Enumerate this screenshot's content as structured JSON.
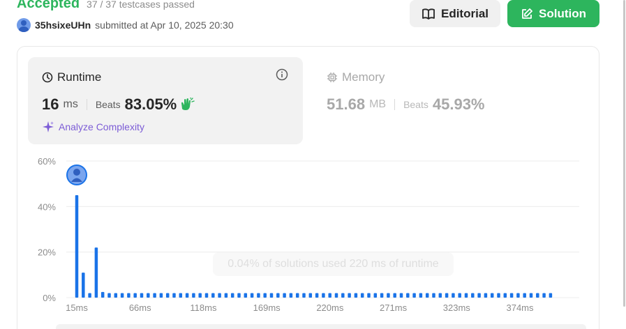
{
  "status": {
    "label": "Accepted",
    "passed": "37 / 37 testcases passed"
  },
  "submitter": {
    "name": "35hsixeUHn",
    "submitted_text": "submitted at Apr 10, 2025 20:30"
  },
  "buttons": {
    "editorial": "Editorial",
    "solution": "Solution"
  },
  "runtime": {
    "title": "Runtime",
    "value": "16",
    "unit": "ms",
    "beats_label": "Beats",
    "beats_value": "83.05%",
    "analyze": "Analyze Complexity"
  },
  "memory": {
    "title": "Memory",
    "value": "51.68",
    "unit": "MB",
    "beats_label": "Beats",
    "beats_value": "45.93%"
  },
  "tooltip": "0.04% of solutions used 220 ms of runtime",
  "colors": {
    "accent_green": "#2db55d",
    "bar_blue": "#1a73e8",
    "analyze_purple": "#7c5cd6"
  },
  "chart_data": {
    "type": "bar",
    "ytick_labels": [
      "0%",
      "20%",
      "40%",
      "60%"
    ],
    "ylim": [
      0,
      60
    ],
    "xtick_labels": [
      "15ms",
      "66ms",
      "118ms",
      "169ms",
      "220ms",
      "271ms",
      "323ms",
      "374ms"
    ],
    "values": [
      45,
      11,
      2,
      22,
      2.5,
      2,
      2,
      2,
      2,
      2,
      2,
      2,
      2,
      2,
      2,
      2,
      2,
      2,
      2,
      2,
      2,
      2,
      2,
      2,
      2,
      2,
      2,
      2,
      2,
      2,
      2,
      2,
      2,
      2,
      2,
      2,
      2,
      2,
      2,
      2,
      2,
      2,
      2,
      2,
      2,
      2,
      2,
      2,
      2,
      2,
      2,
      2,
      2,
      2,
      2,
      2,
      2,
      2,
      2,
      2,
      2,
      2,
      2,
      2,
      2,
      2,
      2,
      2,
      2,
      2,
      2,
      2,
      2,
      2
    ],
    "highlight_index": 0
  }
}
